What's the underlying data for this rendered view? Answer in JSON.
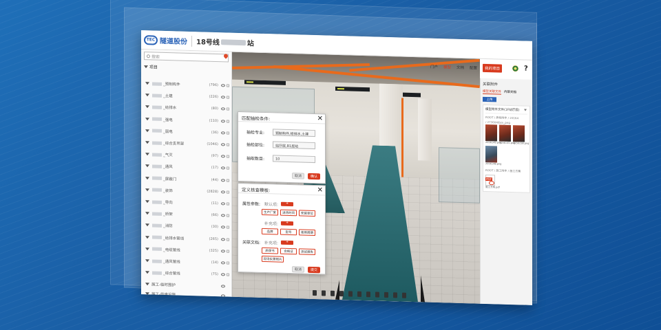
{
  "app": {
    "logo_mark": "TEC",
    "logo_text": "隧道股份",
    "project_prefix": "18号线",
    "project_suffix": "站"
  },
  "nav": {
    "items": [
      "门户",
      "模型",
      "文档",
      "配置"
    ],
    "active": "模型",
    "my_project": "我的项目",
    "help": "?"
  },
  "left": {
    "search_placeholder": "搜索",
    "root": "项目",
    "items": [
      {
        "label": "_预制构件",
        "count": "(796)"
      },
      {
        "label": "_土建",
        "count": "(226)"
      },
      {
        "label": "_给排水",
        "count": "(80)"
      },
      {
        "label": "_强电",
        "count": "(110)"
      },
      {
        "label": "_弱电",
        "count": "(36)"
      },
      {
        "label": "_综合支吊架",
        "count": "(1046)"
      },
      {
        "label": "_气灭",
        "count": "(97)"
      },
      {
        "label": "_通风",
        "count": "(17)"
      },
      {
        "label": "_屏蔽门",
        "count": "(44)"
      },
      {
        "label": "_装饰",
        "count": "(2828)"
      },
      {
        "label": "_导向",
        "count": "(11)"
      },
      {
        "label": "_桥架",
        "count": "(66)"
      },
      {
        "label": "_消防",
        "count": "(30)"
      },
      {
        "label": "_给排水管线",
        "count": "(265)"
      },
      {
        "label": "_电缆管线",
        "count": "(325)"
      },
      {
        "label": "_通风管线",
        "count": "(14)"
      },
      {
        "label": "_综合管线",
        "count": "(75)"
      }
    ],
    "group_items": [
      "施工-临时围护",
      "施工-临电设施"
    ]
  },
  "dialog_match": {
    "title": "匹配抽检条件:",
    "fields": [
      {
        "label": "抽检专业:",
        "value": "预制构件,给排水,土建"
      },
      {
        "label": "抽检部位:",
        "value": "站厅层,B1层站"
      },
      {
        "label": "抽取数目:",
        "value": "10"
      }
    ],
    "cancel": "取消",
    "confirm": "确认"
  },
  "dialog_template": {
    "title": "定义核查模板:",
    "attr_label": "属性参数:",
    "default_label": "默认项:",
    "attr_tags": [
      "生产厂家",
      "进场时间",
      "安装单位"
    ],
    "supp_label": "补充项:",
    "supp_tags": [
      "品牌",
      "型号",
      "使用周期"
    ],
    "assoc_label": "关联文档:",
    "assoc_default": "补充项:",
    "assoc_tags": [
      "质保书",
      "合格证",
      "测试报告",
      "现场实景照片"
    ],
    "cancel": "取消",
    "confirm": "提交"
  },
  "right_panel": {
    "title": "关联附件",
    "tabs": [
      "模型关联文件",
      "内部文档"
    ],
    "active_tab": "模型关联文件",
    "upload": "上传",
    "card_title": "模型附件文件(1F站厅层)",
    "path1": "ROOT / 质检附件 / 20164",
    "path1b": "/ 273604/bzx_png",
    "thumb_captions": [
      "2056149.png",
      "2056145.png",
      "2056158.png",
      "2056148.png"
    ],
    "path2": "ROOT / 施工附件 / 施工方案",
    "pdf_label": "PDF",
    "pdf_caption": "施工方案.pdf"
  },
  "colors": {
    "accent": "#d83a1e",
    "brand_blue": "#2a63b8",
    "background": "#1a5fa6"
  }
}
